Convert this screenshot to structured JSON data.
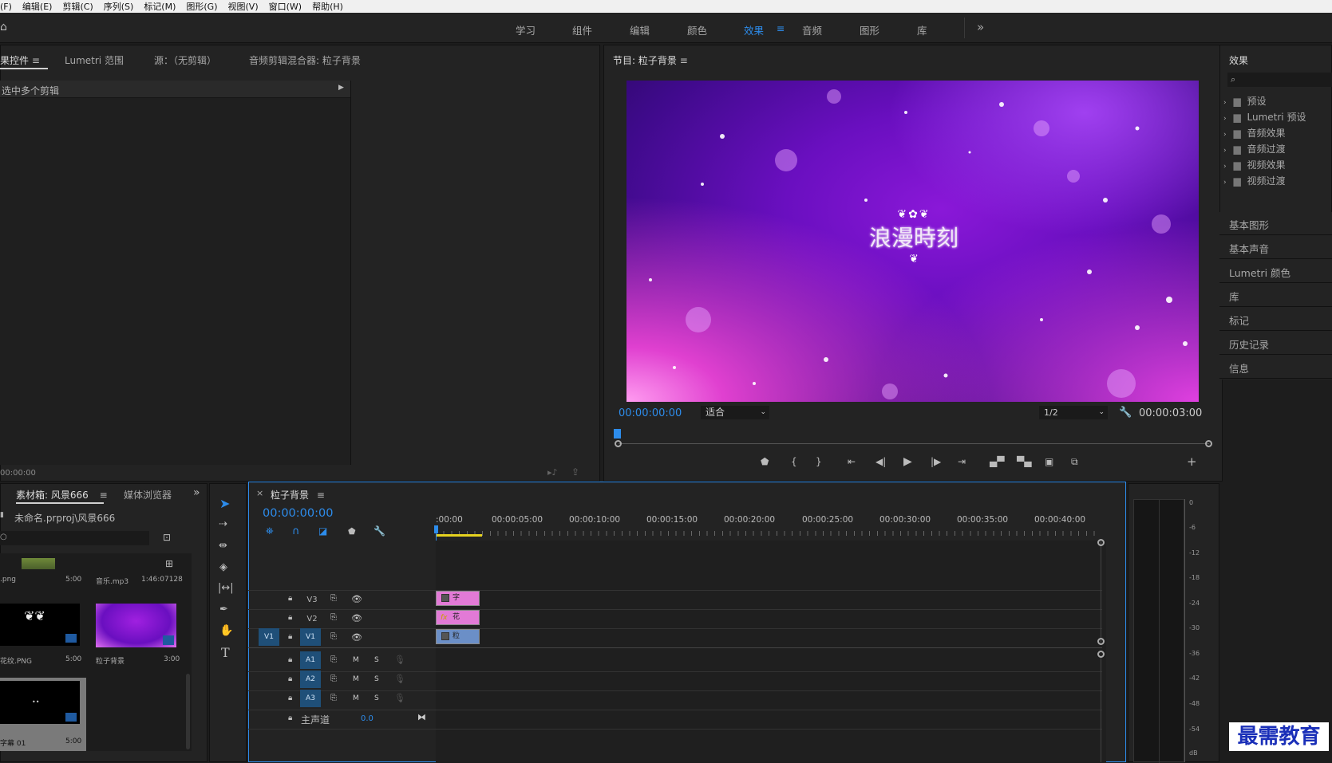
{
  "menubar": [
    "文件(F)",
    "编辑(E)",
    "剪辑(C)",
    "序列(S)",
    "标记(M)",
    "图形(G)",
    "视图(V)",
    "窗口(W)",
    "帮助(H)"
  ],
  "workspaces": [
    "学习",
    "组件",
    "编辑",
    "颜色",
    "效果",
    "音频",
    "图形",
    "库"
  ],
  "effect_controls": {
    "tabs": [
      "效果控件",
      "Lumetri 范围",
      "源：（无剪辑）",
      "音频剪辑混合器: 粒子背景"
    ],
    "header": "选中多个剪辑",
    "timecode": "00:00:00"
  },
  "program": {
    "title": "节目: 粒子背景",
    "overlay_text": "浪漫時刻",
    "timecode": "00:00:00:00",
    "fit": "适合",
    "resolution": "1/2",
    "duration": "00:00:03:00"
  },
  "effects_panel": {
    "title": "效果",
    "folders": [
      "预设",
      "Lumetri 预设",
      "音频效果",
      "音频过渡",
      "视频效果",
      "视频过渡"
    ],
    "panels": [
      "基本图形",
      "基本声音",
      "Lumetri 颜色",
      "库",
      "标记",
      "历史记录",
      "信息"
    ]
  },
  "project": {
    "tabs": [
      "素材箱: 风景666",
      "媒体浏览器"
    ],
    "path": "未命名.prproj\\风景666",
    "items": [
      {
        "name": ".png",
        "duration": "5:00"
      },
      {
        "name": "音乐.mp3",
        "duration": "1:46:07128"
      },
      {
        "name": "花纹.PNG",
        "duration": "5:00"
      },
      {
        "name": "粒子背景",
        "duration": "3:00"
      },
      {
        "name": "字幕 01",
        "duration": "5:00"
      }
    ]
  },
  "timeline": {
    "title": "粒子背景",
    "timecode": "00:00:00:00",
    "ruler": [
      ":00:00",
      "00:00:05:00",
      "00:00:10:00",
      "00:00:15:00",
      "00:00:20:00",
      "00:00:25:00",
      "00:00:30:00",
      "00:00:35:00",
      "00:00:40:00"
    ],
    "video_tracks": [
      "V3",
      "V2",
      "V1"
    ],
    "source_patch": "V1",
    "audio_tracks": [
      "A1",
      "A2",
      "A3"
    ],
    "master": "主声道",
    "master_value": "0.0",
    "clips": [
      {
        "label": "字",
        "color": "#e27ad6"
      },
      {
        "label": "花",
        "color": "#e27ad6"
      },
      {
        "label": "粒",
        "color": "#6b8fc7"
      }
    ]
  },
  "meter": {
    "scale": [
      "0",
      "-6",
      "-12",
      "-18",
      "-24",
      "-30",
      "-36",
      "-42",
      "-48",
      "-54",
      "dB"
    ]
  },
  "watermark": "最需教育"
}
